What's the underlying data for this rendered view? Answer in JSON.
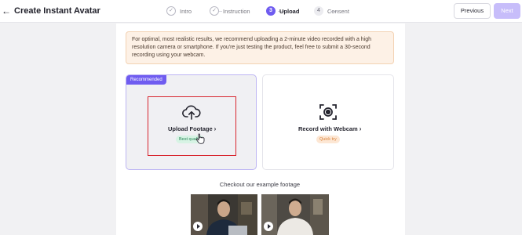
{
  "header": {
    "back_icon": "arrow-left-icon",
    "title": "Create Instant Avatar",
    "steps": [
      {
        "number": "1",
        "label": "Intro",
        "state": "done"
      },
      {
        "number": "2",
        "label": "Instruction",
        "state": "done"
      },
      {
        "number": "3",
        "label": "Upload",
        "state": "active"
      },
      {
        "number": "4",
        "label": "Consent",
        "state": "todo"
      }
    ],
    "previous_label": "Previous",
    "next_label": "Next"
  },
  "notice": {
    "text": "For optimal, most realistic results, we recommend uploading a 2-minute video recorded with a high resolution camera or smartphone. If you're just testing the product, feel free to submit a 30-second recording using your webcam."
  },
  "options": {
    "upload": {
      "badge": "Recommended",
      "title": "Upload Footage",
      "tag": "Best quality",
      "icon": "cloud-upload-icon"
    },
    "webcam": {
      "title": "Record with Webcam",
      "tag": "Quick try",
      "icon": "webcam-record-icon"
    }
  },
  "examples": {
    "heading": "Checkout our example footage",
    "videos": [
      {
        "play_icon": "play-icon"
      },
      {
        "play_icon": "play-icon"
      }
    ]
  },
  "colors": {
    "accent": "#6f5cf0",
    "highlight_box": "#d8252e",
    "notice_bg": "#fdf1e6",
    "best_quality_tag": "#2b8a5a",
    "quick_try_tag": "#d9823a"
  }
}
